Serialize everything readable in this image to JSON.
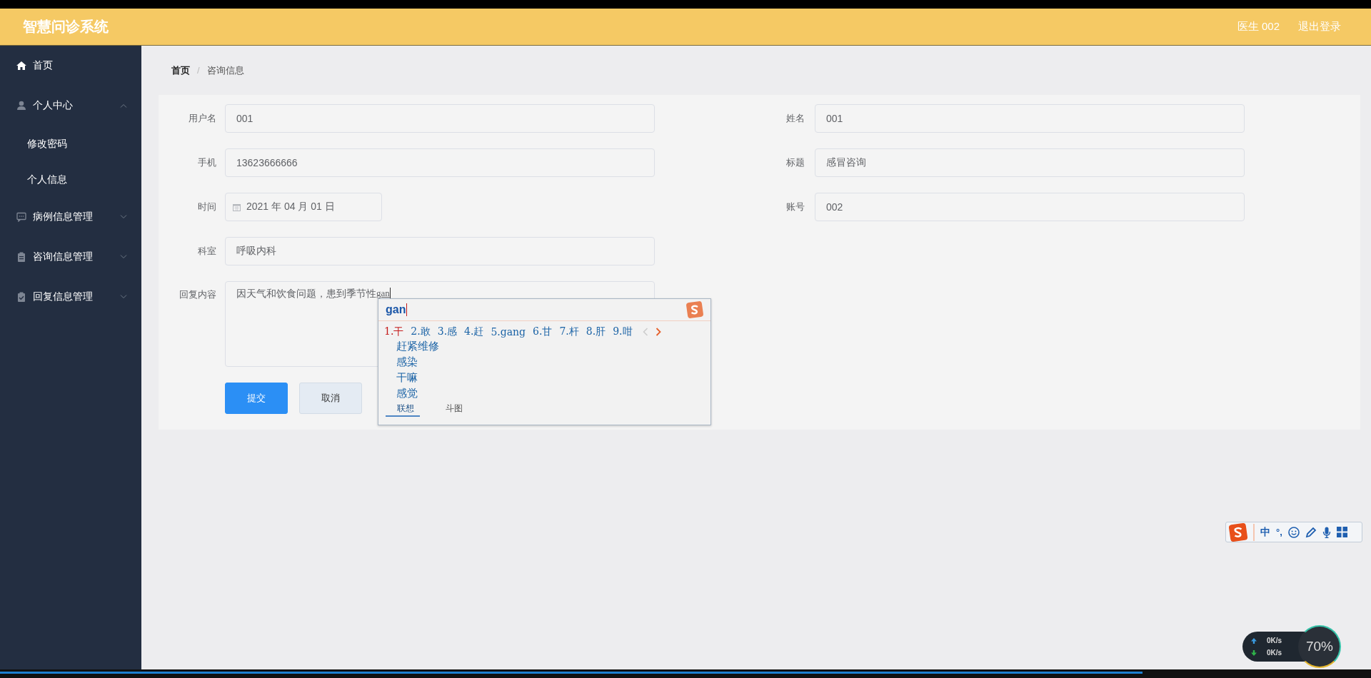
{
  "header": {
    "title": "智慧问诊系统",
    "user": "医生 002",
    "logout": "退出登录"
  },
  "sidebar": {
    "items": [
      {
        "kind": "link",
        "label": "首页",
        "selected": false
      },
      {
        "kind": "group",
        "label": "个人中心",
        "expanded": true,
        "children": [
          {
            "label": "修改密码"
          },
          {
            "label": "个人信息"
          }
        ]
      },
      {
        "kind": "group",
        "label": "病例信息管理",
        "expanded": false
      },
      {
        "kind": "group",
        "label": "咨询信息管理",
        "expanded": false
      },
      {
        "kind": "group",
        "label": "回复信息管理",
        "expanded": false
      }
    ]
  },
  "breadcrumb": [
    {
      "label": "首页",
      "current": false
    },
    {
      "separator": "/"
    },
    {
      "label": "咨询信息",
      "current": true
    }
  ],
  "form": {
    "left": [
      {
        "kind": "text",
        "label": "用户名",
        "value": "001"
      },
      {
        "kind": "text",
        "label": "手机",
        "value": "13623666666"
      },
      {
        "kind": "date",
        "label": "时间",
        "value": "2021 年 04 月 01 日"
      },
      {
        "kind": "text",
        "label": "科室",
        "value": "呼吸内科"
      },
      {
        "kind": "textarea",
        "label": "回复内容",
        "value": "因天气和饮食问题，患到季节性",
        "composition": "gan"
      }
    ],
    "right": [
      {
        "kind": "text",
        "label": "姓名",
        "value": "001"
      },
      {
        "kind": "text",
        "label": "标题",
        "value": "感冒咨询"
      },
      {
        "kind": "text",
        "label": "账号",
        "value": "002"
      }
    ],
    "buttons": [
      {
        "kind": "primary",
        "label": "提交"
      },
      {
        "kind": "default",
        "label": "取消"
      }
    ]
  },
  "ime_popup": {
    "input": "gan",
    "candidates": [
      {
        "label": "1.干",
        "selected": true
      },
      {
        "label": "2.敢",
        "selected": false
      },
      {
        "label": "3.感",
        "selected": false
      },
      {
        "label": "4.赶",
        "selected": false
      },
      {
        "label": "5.gang",
        "selected": false
      },
      {
        "label": "6.甘",
        "selected": false
      },
      {
        "label": "7.杆",
        "selected": false
      },
      {
        "label": "8.肝",
        "selected": false
      },
      {
        "label": "9.咁",
        "selected": false
      }
    ],
    "suggestions": [
      "赶紧维修",
      "感染",
      "干嘛",
      "感觉"
    ],
    "tabs": [
      {
        "label": "联想",
        "selected": true
      },
      {
        "label": "斗图",
        "selected": false
      }
    ]
  },
  "ime_toolbar": {
    "mode": "中",
    "punct": "°,"
  },
  "speed_widget": {
    "upload": "0K/s",
    "download": "0K/s",
    "percent": "70%"
  }
}
